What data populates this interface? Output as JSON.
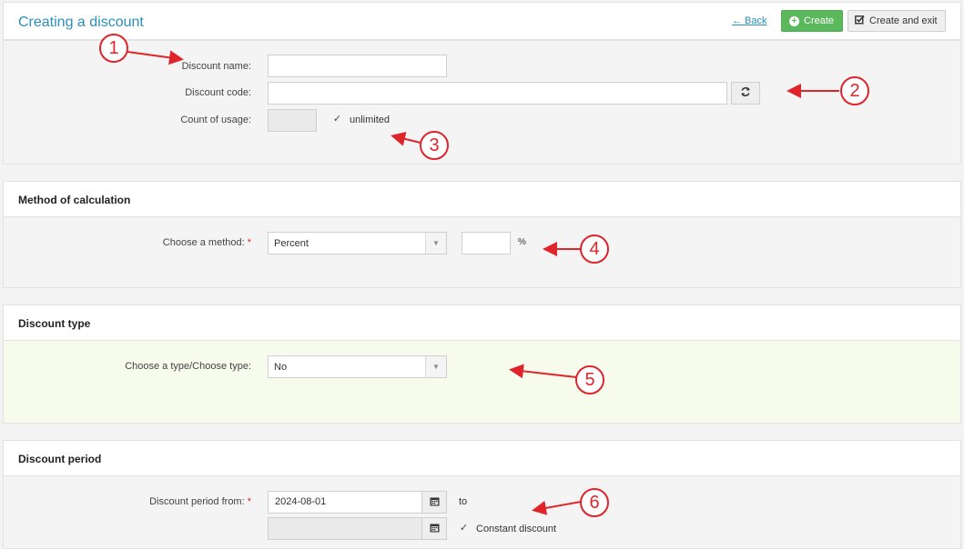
{
  "header": {
    "title": "Creating a discount",
    "back_label": "← Back",
    "create_label": "Create",
    "create_exit_label": "Create and exit"
  },
  "general": {
    "name_label": "Discount name:",
    "name_value": "",
    "code_label": "Discount code:",
    "code_value": "",
    "usage_label": "Count of usage:",
    "usage_value": "",
    "unlimited_label": "unlimited",
    "unlimited_checked": "✓"
  },
  "method": {
    "heading": "Method of calculation",
    "label": "Choose a method:",
    "required": "*",
    "selected": "Percent",
    "amount_value": "",
    "unit": "%"
  },
  "type": {
    "heading": "Discount type",
    "label": "Choose a type/Choose type:",
    "selected": "No"
  },
  "period": {
    "heading": "Discount period",
    "label": "Discount period from:",
    "required": "*",
    "from_value": "2024-08-01",
    "to_label": "to",
    "to_value": "",
    "constant_label": "Constant discount",
    "constant_checked": "✓"
  },
  "annotations": [
    "1",
    "2",
    "3",
    "4",
    "5",
    "6"
  ],
  "colors": {
    "accent": "#2a8fbd",
    "success": "#5cb85c",
    "annotation": "#e0242b",
    "highlight": "#f7fbec"
  }
}
